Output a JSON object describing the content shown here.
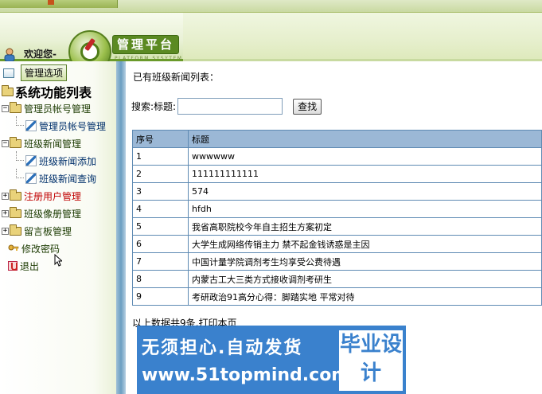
{
  "header": {
    "welcome": "欢迎您-",
    "brand": "管理平台",
    "brand_sub": "PLATFORM SYSYTEM"
  },
  "sidebar": {
    "menu_button": "管理选项",
    "tree_title": "系统功能列表",
    "nodes": [
      {
        "label": "管理员帐号管理"
      },
      {
        "label": "管理员帐号管理"
      },
      {
        "label": "班级新闻管理"
      },
      {
        "label": "班级新闻添加"
      },
      {
        "label": "班级新闻查询"
      },
      {
        "label": "注册用户管理"
      },
      {
        "label": "班级像册管理"
      },
      {
        "label": "留言板管理"
      },
      {
        "label": "修改密码"
      },
      {
        "label": "退出"
      }
    ]
  },
  "main": {
    "caption": "已有班级新闻列表：",
    "search_label": "搜索:标题:",
    "search_value": "",
    "search_button": "查找",
    "columns": [
      "序号",
      "标题"
    ],
    "rows": [
      [
        "1",
        "wwwwww"
      ],
      [
        "2",
        "111111111111"
      ],
      [
        "3",
        "574"
      ],
      [
        "4",
        "hfdh"
      ],
      [
        "5",
        "我省高职院校今年自主招生方案初定"
      ],
      [
        "6",
        "大学生成网络传销主力 禁不起金钱诱惑是主因"
      ],
      [
        "7",
        "中国计量学院调剂考生均享受公费待遇"
      ],
      [
        "8",
        "内蒙古工大三类方式接收调剂考研生"
      ],
      [
        "9",
        "考研政治91高分心得：脚踏实地 平常对待"
      ]
    ],
    "footer": "以上数据共9条,打印本页"
  },
  "watermark": {
    "line1": "无须担心.自动发货",
    "line2": "www.51topmind.com",
    "box": "毕业设计"
  }
}
